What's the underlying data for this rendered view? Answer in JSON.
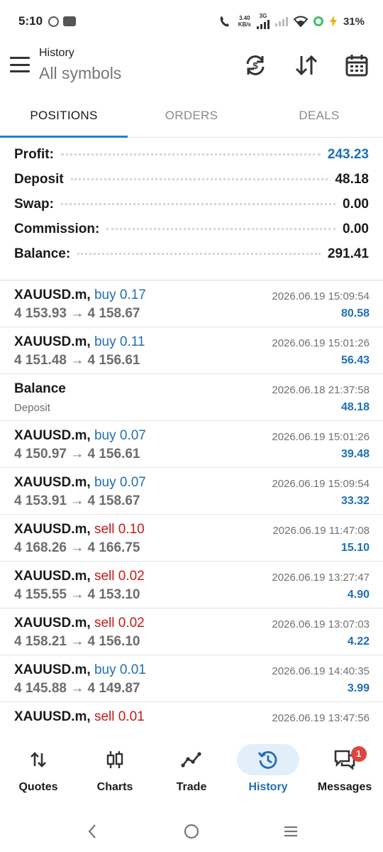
{
  "status_bar": {
    "time": "5:10",
    "speed_top": "3.40",
    "speed_unit": "KB/s",
    "network": "3G",
    "battery": "31%"
  },
  "header": {
    "subtitle": "History",
    "title": "All symbols",
    "icons": [
      "sync-icon",
      "sort-icon",
      "calendar-icon"
    ]
  },
  "tabs": [
    {
      "label": "POSITIONS",
      "active": true
    },
    {
      "label": "ORDERS",
      "active": false
    },
    {
      "label": "DEALS",
      "active": false
    }
  ],
  "summary": [
    {
      "label": "Profit:",
      "value": "243.23",
      "highlight": true
    },
    {
      "label": "Deposit",
      "value": "48.18",
      "highlight": false
    },
    {
      "label": "Swap:",
      "value": "0.00",
      "highlight": false
    },
    {
      "label": "Commission:",
      "value": "0.00",
      "highlight": false
    },
    {
      "label": "Balance:",
      "value": "291.41",
      "highlight": false
    }
  ],
  "rows": [
    {
      "symbol": "XAUUSD.m,",
      "direction": "buy 0.17",
      "side": "buy",
      "prices": "4 153.93 → 4 158.67",
      "time": "2026.06.19 15:09:54",
      "profit": "80.58"
    },
    {
      "symbol": "XAUUSD.m,",
      "direction": "buy 0.11",
      "side": "buy",
      "prices": "4 151.48 → 4 156.61",
      "time": "2026.06.19 15:01:26",
      "profit": "56.43"
    },
    {
      "symbol": "Balance",
      "direction": "",
      "side": "none",
      "prices": "Deposit",
      "time": "2026.06.18 21:37:58",
      "profit": "48.18"
    },
    {
      "symbol": "XAUUSD.m,",
      "direction": "buy 0.07",
      "side": "buy",
      "prices": "4 150.97 → 4 156.61",
      "time": "2026.06.19 15:01:26",
      "profit": "39.48"
    },
    {
      "symbol": "XAUUSD.m,",
      "direction": "buy 0.07",
      "side": "buy",
      "prices": "4 153.91 → 4 158.67",
      "time": "2026.06.19 15:09:54",
      "profit": "33.32"
    },
    {
      "symbol": "XAUUSD.m,",
      "direction": "sell 0.10",
      "side": "sell",
      "prices": "4 168.26 → 4 166.75",
      "time": "2026.06.19 11:47:08",
      "profit": "15.10"
    },
    {
      "symbol": "XAUUSD.m,",
      "direction": "sell 0.02",
      "side": "sell",
      "prices": "4 155.55 → 4 153.10",
      "time": "2026.06.19 13:27:47",
      "profit": "4.90"
    },
    {
      "symbol": "XAUUSD.m,",
      "direction": "sell 0.02",
      "side": "sell",
      "prices": "4 158.21 → 4 156.10",
      "time": "2026.06.19 13:07:03",
      "profit": "4.22"
    },
    {
      "symbol": "XAUUSD.m,",
      "direction": "buy 0.01",
      "side": "buy",
      "prices": "4 145.88 → 4 149.87",
      "time": "2026.06.19 14:40:35",
      "profit": "3.99"
    },
    {
      "symbol": "XAUUSD.m,",
      "direction": "sell 0.01",
      "side": "sell",
      "prices": "",
      "time": "2026.06.19 13:47:56",
      "profit": ""
    }
  ],
  "bottom_nav": [
    {
      "label": "Quotes",
      "icon": "quotes-icon",
      "active": false
    },
    {
      "label": "Charts",
      "icon": "candlestick-icon",
      "active": false
    },
    {
      "label": "Trade",
      "icon": "trend-line-icon",
      "active": false
    },
    {
      "label": "History",
      "icon": "history-icon",
      "active": true
    },
    {
      "label": "Messages",
      "icon": "chat-icon",
      "active": false,
      "badge": "1"
    }
  ],
  "colors": {
    "accent": "#1f6fb5",
    "sell": "#c41a1a",
    "tab_indicator": "#2a7ec4",
    "active_nav_bg": "#e3eefb",
    "badge": "#e0443e"
  }
}
